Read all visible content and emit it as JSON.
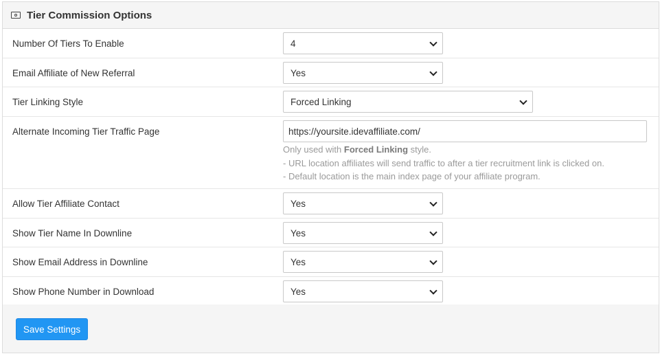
{
  "panel": {
    "title": "Tier Commission Options",
    "icon": "money-bill-icon"
  },
  "rows": [
    {
      "label": "Number Of Tiers To Enable",
      "value": "4"
    },
    {
      "label": "Email Affiliate of New Referral",
      "value": "Yes"
    },
    {
      "label": "Tier Linking Style",
      "value": "Forced Linking"
    },
    {
      "label": "Alternate Incoming Tier Traffic Page",
      "value": "https://yoursite.idevaffiliate.com/",
      "help": {
        "prefix": "Only used with ",
        "bold": "Forced Linking",
        "suffix": " style.",
        "line2": "- URL location affiliates will send traffic to after a tier recruitment link is clicked on.",
        "line3": "- Default location is the main index page of your affiliate program."
      }
    },
    {
      "label": "Allow Tier Affiliate Contact",
      "value": "Yes"
    },
    {
      "label": "Show Tier Name In Downline",
      "value": "Yes"
    },
    {
      "label": "Show Email Address in Downline",
      "value": "Yes"
    },
    {
      "label": "Show Phone Number in Download",
      "value": "Yes"
    }
  ],
  "footer": {
    "save_label": "Save Settings"
  }
}
